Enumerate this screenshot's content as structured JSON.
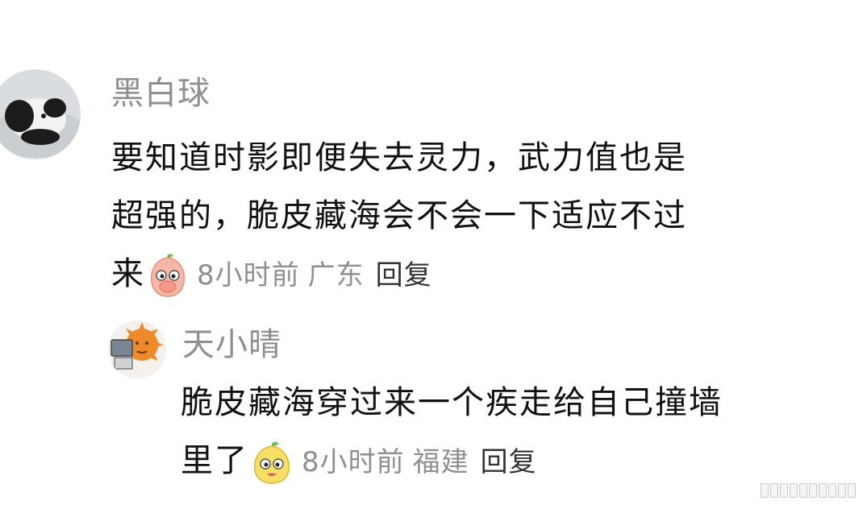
{
  "comment": {
    "username": "黑白球",
    "line1": "要知道时影即便失去灵力，武力值也是",
    "line2": "超强的，脆皮藏海会不会一下适应不过",
    "line3": "来",
    "emoji_icon": "covering-mouth-peach-emoji",
    "time": "8小时前",
    "location": "广东",
    "reply_label": "回复"
  },
  "reply": {
    "username": "天小晴",
    "line1": "脆皮藏海穿过来一个疾走给自己撞墙",
    "line2": "里了",
    "emoji_icon": "smiling-mango-emoji",
    "time": "8小时前",
    "location": "福建",
    "reply_label": "回复"
  },
  "colors": {
    "username": "#8f8f8f",
    "text": "#111111",
    "meta": "#8f8f8f",
    "reply_link": "#333333"
  }
}
